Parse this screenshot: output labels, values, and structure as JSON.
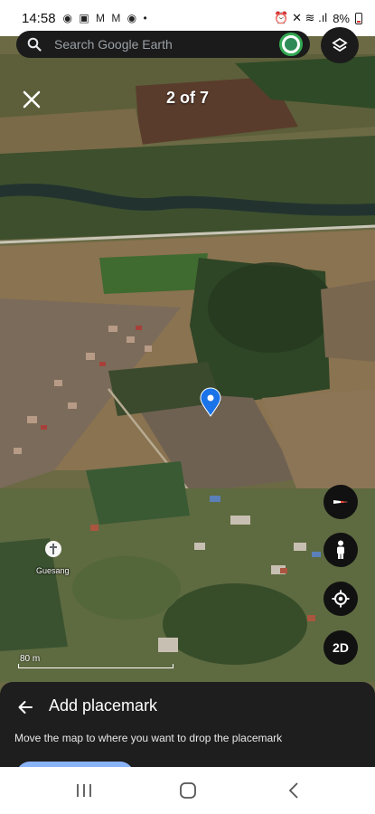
{
  "status_bar": {
    "time": "14:58",
    "notification_glyphs": "◉ ▣ M M ◉ •",
    "right_glyphs": "⏰ ✕ ≋ .ıl",
    "battery": "8%"
  },
  "search": {
    "placeholder": "Search Google Earth"
  },
  "result_counter": "2 of 7",
  "map": {
    "place_label": "Guesang",
    "scale_label": "80 m"
  },
  "controls": {
    "view_mode_label": "2D"
  },
  "placemark_sheet": {
    "title": "Add placemark",
    "instructions": "Move the map to where you want to drop the placemark"
  },
  "colors": {
    "accent_blue": "#1a73e8",
    "primary_button": "#8ab4f8",
    "sheet_bg": "#1e1e1e",
    "avatar_ring": "#34a853"
  }
}
